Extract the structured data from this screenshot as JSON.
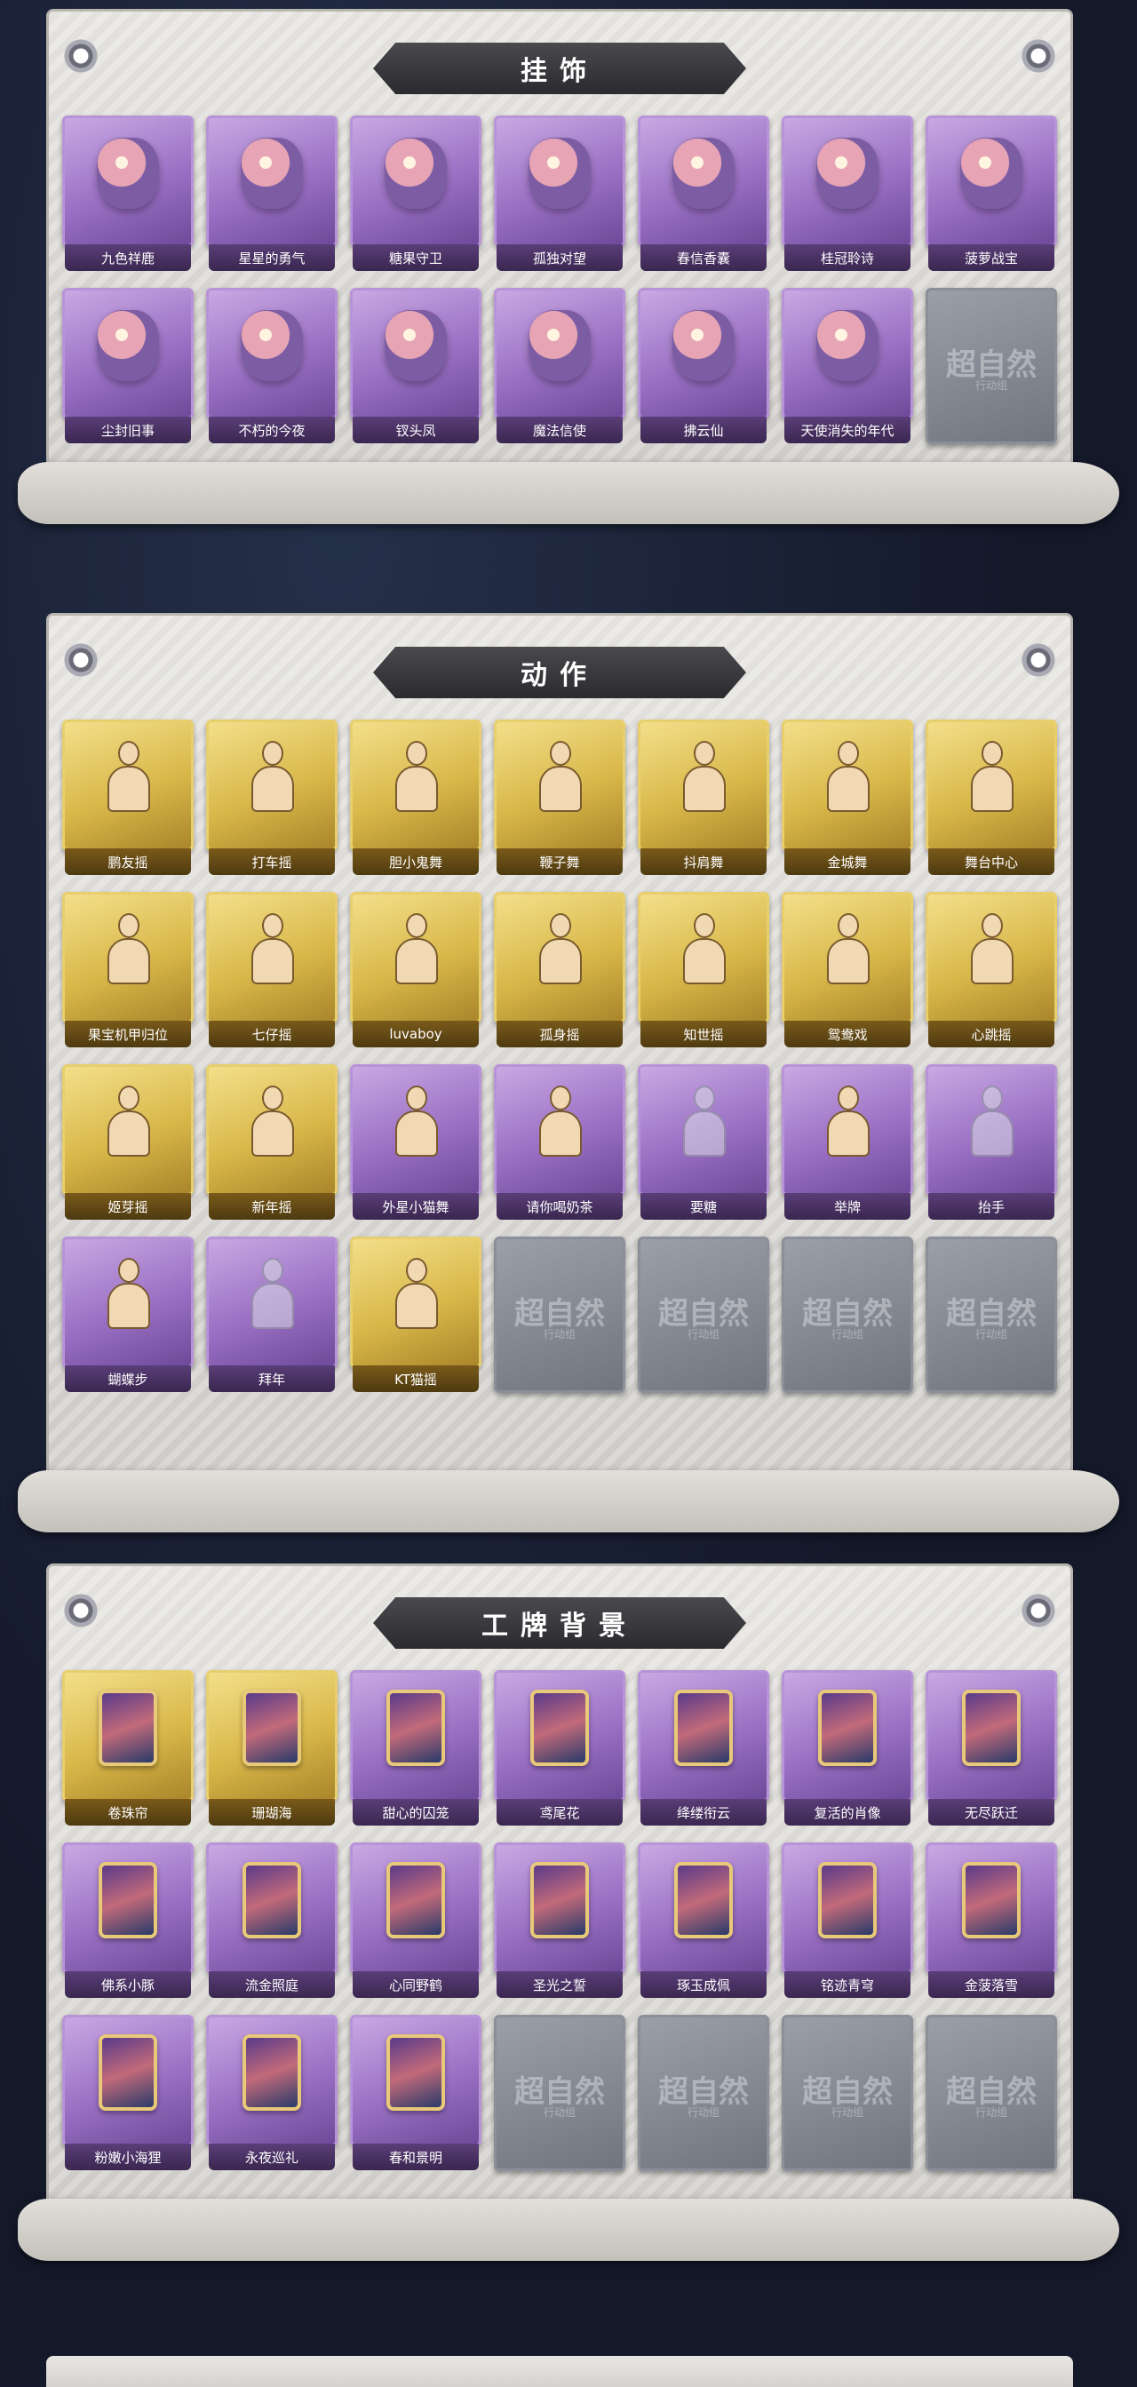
{
  "sections": [
    {
      "title": "挂饰",
      "items": [
        {
          "label": "九色祥鹿",
          "style": "purple"
        },
        {
          "label": "星星的勇气",
          "style": "purple"
        },
        {
          "label": "糖果守卫",
          "style": "purple"
        },
        {
          "label": "孤独对望",
          "style": "purple"
        },
        {
          "label": "春信香囊",
          "style": "purple"
        },
        {
          "label": "桂冠聆诗",
          "style": "purple"
        },
        {
          "label": "菠萝战宝",
          "style": "purple"
        },
        {
          "label": "尘封旧事",
          "style": "purple"
        },
        {
          "label": "不朽的今夜",
          "style": "purple"
        },
        {
          "label": "钗头凤",
          "style": "purple"
        },
        {
          "label": "魔法信使",
          "style": "purple"
        },
        {
          "label": "拂云仙",
          "style": "purple"
        },
        {
          "label": "天使消失的年代",
          "style": "purple"
        }
      ],
      "locked_count": 1
    },
    {
      "title": "动作",
      "items": [
        {
          "label": "鹏友摇",
          "style": "gold"
        },
        {
          "label": "打车摇",
          "style": "gold"
        },
        {
          "label": "胆小鬼舞",
          "style": "gold"
        },
        {
          "label": "鞭子舞",
          "style": "gold"
        },
        {
          "label": "抖肩舞",
          "style": "gold"
        },
        {
          "label": "金城舞",
          "style": "gold"
        },
        {
          "label": "舞台中心",
          "style": "gold"
        },
        {
          "label": "果宝机甲归位",
          "style": "gold"
        },
        {
          "label": "七仔摇",
          "style": "gold"
        },
        {
          "label": "luvaboy",
          "style": "gold"
        },
        {
          "label": "孤身摇",
          "style": "gold"
        },
        {
          "label": "知世摇",
          "style": "gold"
        },
        {
          "label": "鸳鸯戏",
          "style": "gold"
        },
        {
          "label": "心跳摇",
          "style": "gold"
        },
        {
          "label": "姬芽摇",
          "style": "gold"
        },
        {
          "label": "新年摇",
          "style": "gold"
        },
        {
          "label": "外星小猫舞",
          "style": "purple"
        },
        {
          "label": "请你喝奶茶",
          "style": "purple"
        },
        {
          "label": "要糖",
          "style": "purple"
        },
        {
          "label": "举牌",
          "style": "purple"
        },
        {
          "label": "抬手",
          "style": "purple"
        },
        {
          "label": "蝴蝶步",
          "style": "purple"
        },
        {
          "label": "拜年",
          "style": "purple"
        },
        {
          "label": "KT猫摇",
          "style": "gold"
        }
      ],
      "locked_count": 4
    },
    {
      "title": "工牌背景",
      "items": [
        {
          "label": "卷珠帘",
          "style": "gold"
        },
        {
          "label": "珊瑚海",
          "style": "gold"
        },
        {
          "label": "甜心的囚笼",
          "style": "purple"
        },
        {
          "label": "鸢尾花",
          "style": "purple"
        },
        {
          "label": "绛缕衔云",
          "style": "purple"
        },
        {
          "label": "复活的肖像",
          "style": "purple"
        },
        {
          "label": "无尽跃迁",
          "style": "purple"
        },
        {
          "label": "佛系小豚",
          "style": "purple"
        },
        {
          "label": "流金照庭",
          "style": "purple"
        },
        {
          "label": "心同野鹤",
          "style": "purple"
        },
        {
          "label": "圣光之誓",
          "style": "purple"
        },
        {
          "label": "琢玉成佩",
          "style": "purple"
        },
        {
          "label": "铭迹青穹",
          "style": "purple"
        },
        {
          "label": "金菠落雪",
          "style": "purple"
        },
        {
          "label": "粉嫩小海狸",
          "style": "purple"
        },
        {
          "label": "永夜巡礼",
          "style": "purple"
        },
        {
          "label": "春和景明",
          "style": "purple"
        }
      ],
      "locked_count": 4
    }
  ],
  "locked_watermark": "超自然",
  "locked_watermark_sub": "行动组",
  "colors": {
    "purple": "#9a70c4",
    "gold": "#d9b84a",
    "locked": "#707680",
    "banner": "#2b2b2f"
  }
}
